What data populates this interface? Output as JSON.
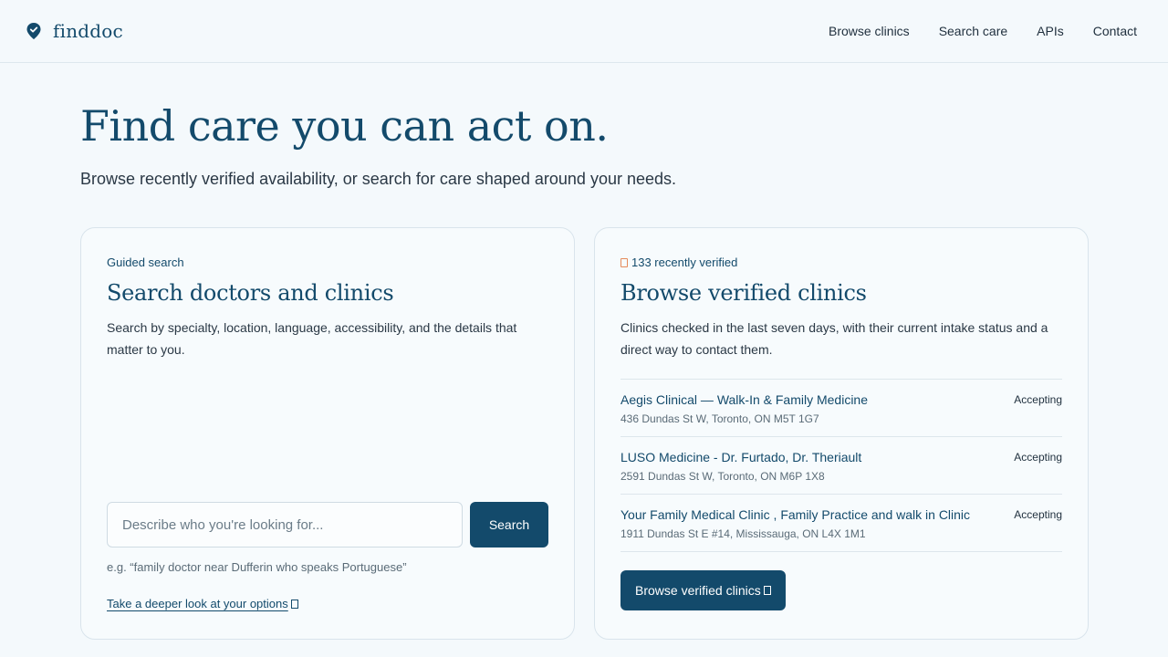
{
  "header": {
    "brand": "finddoc",
    "nav": [
      "Browse clinics",
      "Search care",
      "APIs",
      "Contact"
    ]
  },
  "hero": {
    "title": "Find care you can act on.",
    "subtitle": "Browse recently verified availability, or search for care shaped around your needs."
  },
  "search_card": {
    "eyebrow": "Guided search",
    "title": "Search doctors and clinics",
    "description": "Search by specialty, location, language, accessibility, and the details that matter to you.",
    "placeholder": "Describe who you're looking for...",
    "button": "Search",
    "example": "e.g. “family doctor near Dufferin who speaks Portuguese”",
    "deeper_link": "Take a deeper look at your options"
  },
  "browse_card": {
    "eyebrow": "133 recently verified",
    "title": "Browse verified clinics",
    "description": "Clinics checked in the last seven days, with their current intake status and a direct way to contact them.",
    "clinics": [
      {
        "name": "Aegis Clinical — Walk-In & Family Medicine",
        "address": "436 Dundas St W, Toronto, ON M5T 1G7",
        "status": "Accepting"
      },
      {
        "name": "LUSO Medicine - Dr. Furtado, Dr. Theriault",
        "address": "2591 Dundas St W, Toronto, ON M6P 1X8",
        "status": "Accepting"
      },
      {
        "name": "Your Family Medical Clinic , Family Practice and walk in Clinic",
        "address": "1911 Dundas St E #14, Mississauga, ON L4X 1M1",
        "status": "Accepting"
      }
    ],
    "button": "Browse verified clinics"
  },
  "colors": {
    "accent": "#134a6b",
    "background": "#f4f9fc",
    "badge": "#e58a5a"
  },
  "icons": {
    "brand": "location-pin-icon",
    "verified": "badge-icon",
    "arrow": "arrow-right-icon"
  }
}
